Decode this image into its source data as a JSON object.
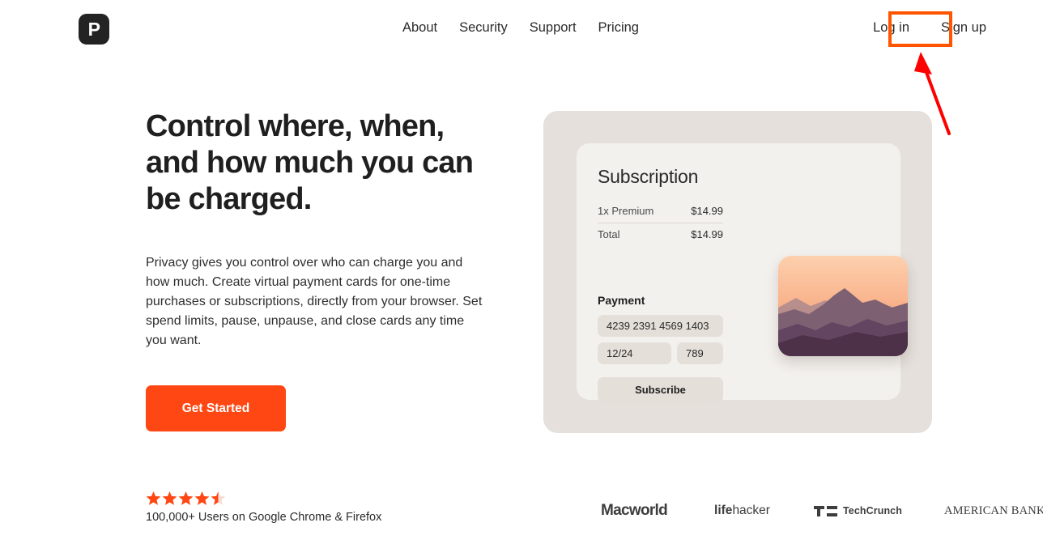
{
  "brand": {
    "logo_letter": "P",
    "accent_color": "#FF4713",
    "annotation_color": "#FF5500"
  },
  "header": {
    "nav_items": [
      {
        "label": "About"
      },
      {
        "label": "Security"
      },
      {
        "label": "Support"
      },
      {
        "label": "Pricing"
      }
    ],
    "auth": {
      "login_label": "Log in",
      "signup_label": "Sign up"
    }
  },
  "annotation": {
    "type": "highlight-box-with-arrow",
    "target": "Log in",
    "color": "#FF5500",
    "arrow_color": "#FF0000"
  },
  "hero": {
    "headline": "Control where, when, and how much you can be charged.",
    "body": "Privacy gives you control over who can charge you and how much. Create virtual payment cards for one-time purchases or subscriptions, directly from your browser. Set spend limits, pause, unpause, and close cards any time you want.",
    "cta_label": "Get Started"
  },
  "subscription_card": {
    "title": "Subscription",
    "line_items": [
      {
        "label": "1x Premium",
        "amount": "$14.99"
      },
      {
        "label": "Total",
        "amount": "$14.99"
      }
    ],
    "payment_label": "Payment",
    "fields": {
      "card_number": "4239 2391 4569 1403",
      "expiry": "12/24",
      "cvv": "789"
    },
    "subscribe_label": "Subscribe",
    "thumbnail": {
      "name": "mountain-sunset-thumbnail",
      "sky_top": "#FCC6A0",
      "sky_bottom": "#F09A74",
      "ridge_far": "#9B7E8C",
      "ridge_mid": "#7A5E70",
      "ridge_near": "#5C3F52",
      "ridge_front": "#4A3143"
    }
  },
  "footer": {
    "rating": {
      "value": 4.5,
      "max": 5,
      "star_color": "#FF4713",
      "caption": "100,000+ Users on Google Chrome & Firefox"
    },
    "press_logos": [
      {
        "name": "Macworld"
      },
      {
        "name_bold": "life",
        "name_rest": "hacker"
      },
      {
        "name": "TechCrunch"
      },
      {
        "name": "AMERICAN BANKER"
      }
    ]
  }
}
